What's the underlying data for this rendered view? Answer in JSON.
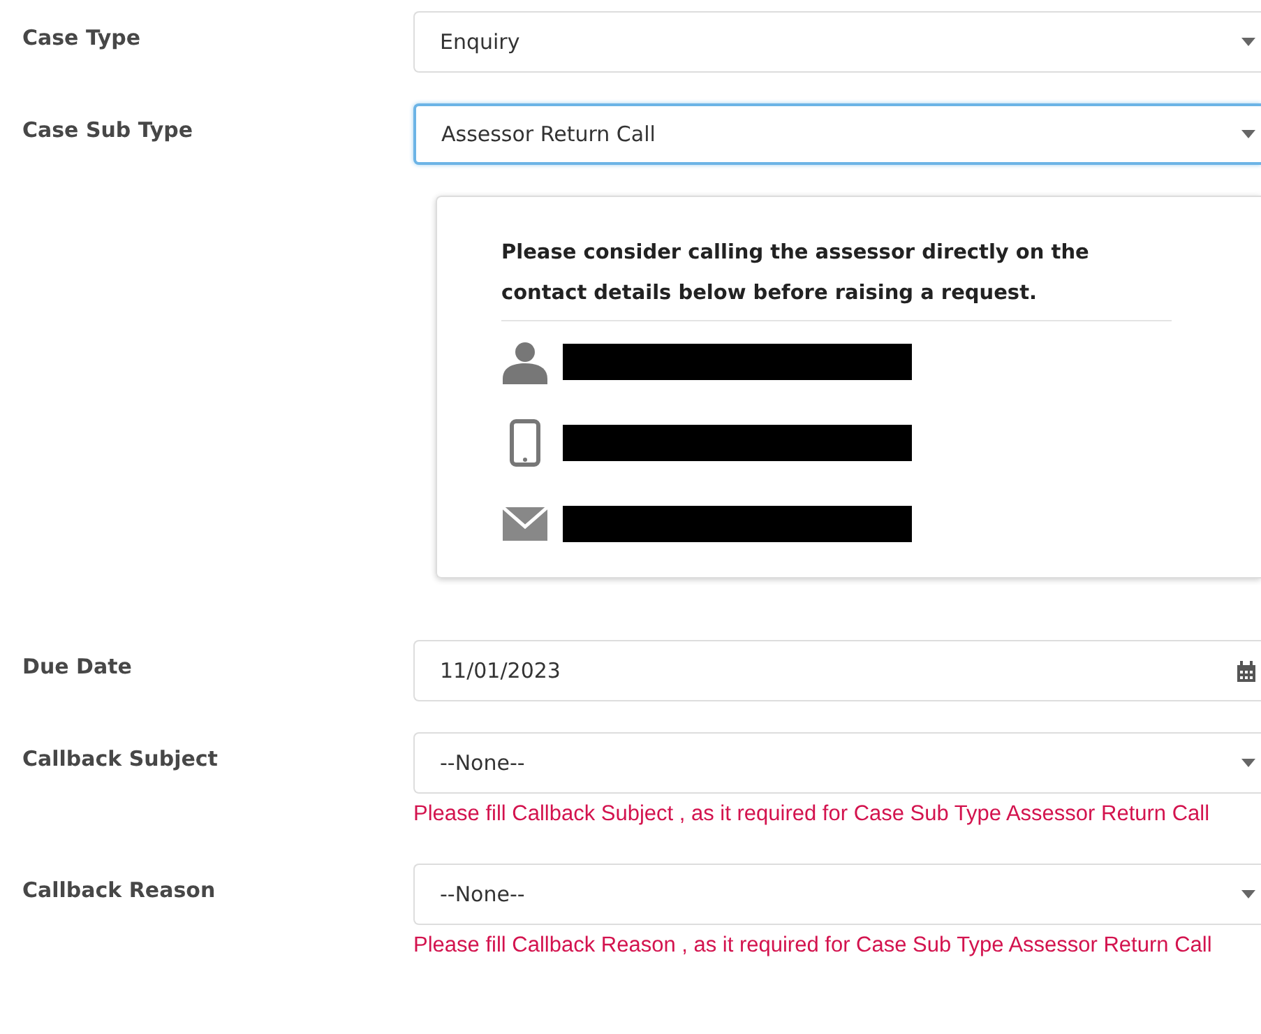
{
  "fields": [
    {
      "kind": "select",
      "label": "Case Type",
      "value": "Enquiry",
      "focused": false
    },
    {
      "kind": "select",
      "label": "Case Sub Type",
      "value": "Assessor Return Call",
      "focused": true
    },
    {
      "kind": "info",
      "message": "Please consider calling the assessor directly on the contact details below before raising a request.",
      "contacts": [
        {
          "kind": "person",
          "redacted": true
        },
        {
          "kind": "phone",
          "redacted": true
        },
        {
          "kind": "email",
          "redacted": true
        }
      ]
    },
    {
      "kind": "date",
      "label": "Due Date",
      "value": "11/01/2023",
      "focused": false
    },
    {
      "kind": "select",
      "label": "Callback Subject",
      "value": "--None--",
      "focused": false,
      "error": "Please fill Callback Subject , as it required for Case Sub Type Assessor Return Call"
    },
    {
      "kind": "select",
      "label": "Callback Reason",
      "value": "--None--",
      "focused": false,
      "error": "Please fill Callback Reason , as it required for Case Sub Type Assessor Return Call"
    }
  ]
}
